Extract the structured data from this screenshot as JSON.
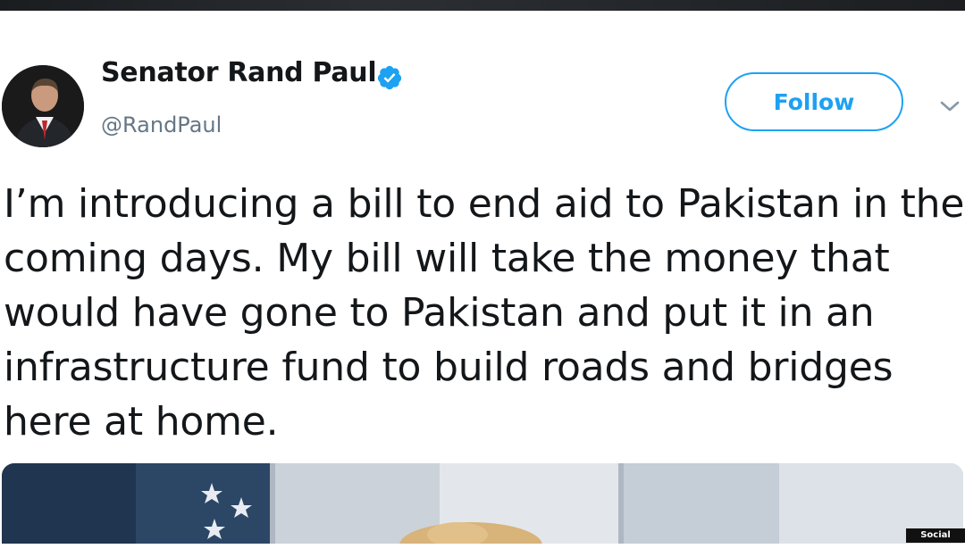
{
  "tweet": {
    "display_name": "Senator Rand Paul",
    "handle": "@RandPaul",
    "verified": true,
    "follow_label": "Follow",
    "text": "I’m introducing a bill to end aid to Pakistan in the coming days. My bill will take the money that would have gone to Pakistan and put it in an infrastructure fund to build roads and bridges here at home."
  },
  "watermark": "Social Media",
  "colors": {
    "accent": "#1da1f2",
    "text": "#14171a",
    "muted": "#657786"
  },
  "icons": {
    "verified": "verified-badge-icon",
    "menu": "chevron-down-icon"
  }
}
